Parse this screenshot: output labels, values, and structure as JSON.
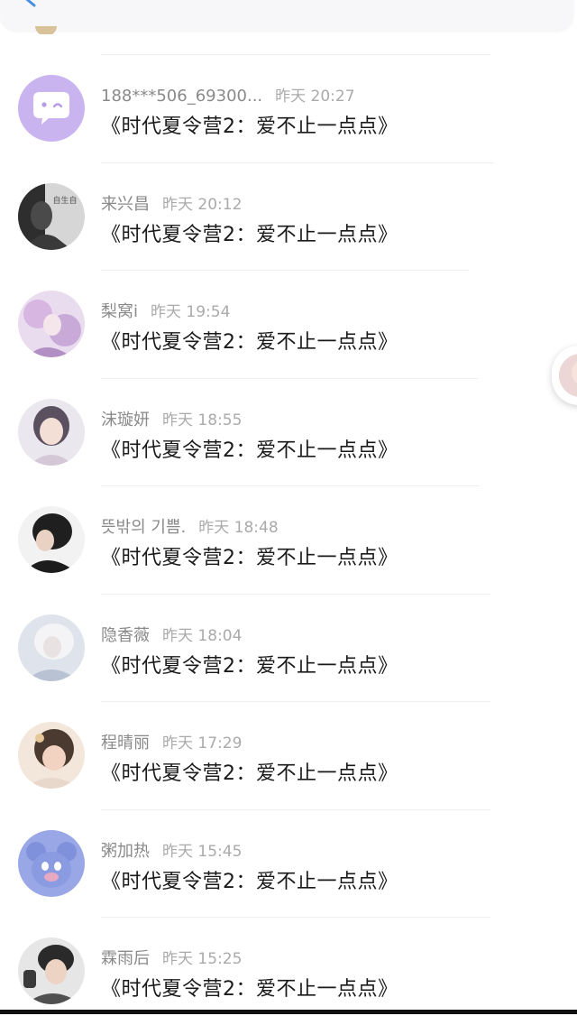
{
  "header": {
    "back_icon": "back-arrow-icon"
  },
  "items": [
    {
      "name": "188***506_69300...",
      "time": "昨天 20:27",
      "title": "《时代夏令营2：爱不止一点点》",
      "avatar_icon": "chat-bubble-avatar",
      "avatar_text": ""
    },
    {
      "name": "来兴昌",
      "time": "昨天 20:12",
      "title": "《时代夏令营2：爱不止一点点》",
      "avatar_icon": "photo-avatar",
      "avatar_text": "自生自"
    },
    {
      "name": "梨窝i",
      "time": "昨天 19:54",
      "title": "《时代夏令营2：爱不止一点点》",
      "avatar_icon": "photo-avatar",
      "avatar_text": ""
    },
    {
      "name": "沫璇妍",
      "time": "昨天 18:55",
      "title": "《时代夏令营2：爱不止一点点》",
      "avatar_icon": "photo-avatar",
      "avatar_text": ""
    },
    {
      "name": "뜻밖의 기쁨.",
      "time": "昨天 18:48",
      "title": "《时代夏令营2：爱不止一点点》",
      "avatar_icon": "photo-avatar",
      "avatar_text": ""
    },
    {
      "name": "隐香薇",
      "time": "昨天 18:04",
      "title": "《时代夏令营2：爱不止一点点》",
      "avatar_icon": "photo-avatar",
      "avatar_text": ""
    },
    {
      "name": "程晴丽",
      "time": "昨天 17:29",
      "title": "《时代夏令营2：爱不止一点点》",
      "avatar_icon": "photo-avatar",
      "avatar_text": ""
    },
    {
      "name": "粥加热",
      "time": "昨天 15:45",
      "title": "《时代夏令营2：爱不止一点点》",
      "avatar_icon": "cartoon-avatar",
      "avatar_text": ""
    },
    {
      "name": "霖雨后",
      "time": "昨天 15:25",
      "title": "《时代夏令营2：爱不止一点点》",
      "avatar_icon": "photo-avatar",
      "avatar_text": ""
    }
  ],
  "colors": {
    "name": "#8a8a8a",
    "time": "#aaaaaa",
    "title": "#1a1a1a",
    "divider": "#eeeeee",
    "default_avatar": "#c9b4f0"
  }
}
